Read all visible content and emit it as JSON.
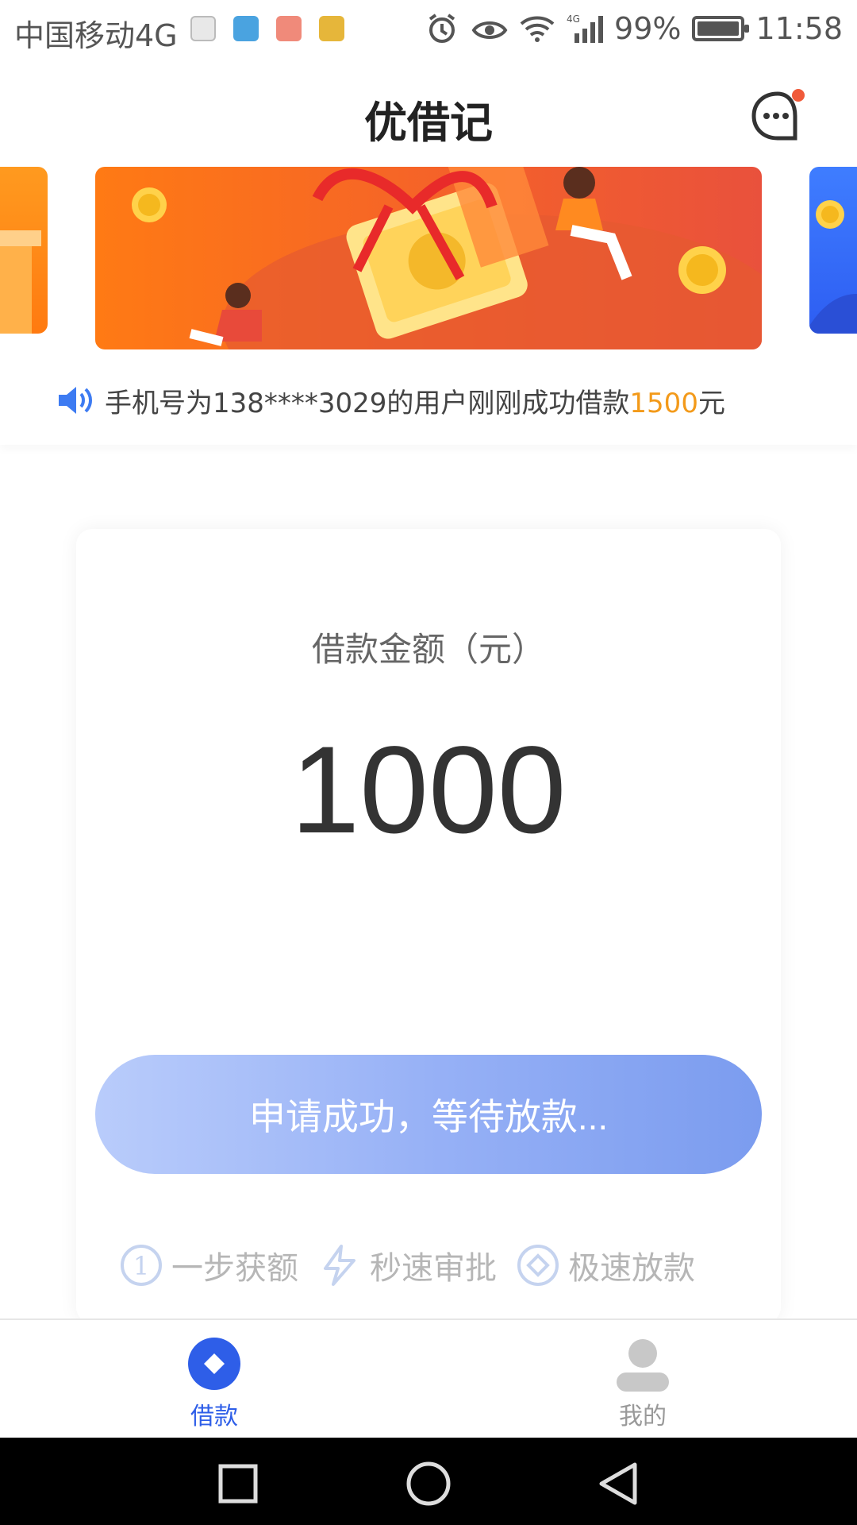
{
  "status_bar": {
    "carrier": "中国移动4G",
    "network_type": "4G",
    "battery": "99%",
    "time": "11:58"
  },
  "header": {
    "title": "优借记"
  },
  "notice": {
    "text": "手机号为138****3029的用户刚刚成功借款",
    "amount": "1500",
    "unit": "元"
  },
  "loan_card": {
    "amount_label": "借款金额（元）",
    "amount_value": "1000",
    "apply_button": "申请成功，等待放款...",
    "features": [
      {
        "icon": "step-one-icon",
        "label": "一步获额"
      },
      {
        "icon": "lightning-icon",
        "label": "秒速审批"
      },
      {
        "icon": "diamond-coin-icon",
        "label": "极速放款"
      }
    ]
  },
  "tab_bar": {
    "items": [
      {
        "label": "借款",
        "active": true
      },
      {
        "label": "我的",
        "active": false
      }
    ]
  },
  "colors": {
    "primary": "#2e5ee8",
    "accent_orange": "#f39a1a",
    "button_gradient_start": "#b9ccfb",
    "button_gradient_end": "#7b9cef"
  }
}
